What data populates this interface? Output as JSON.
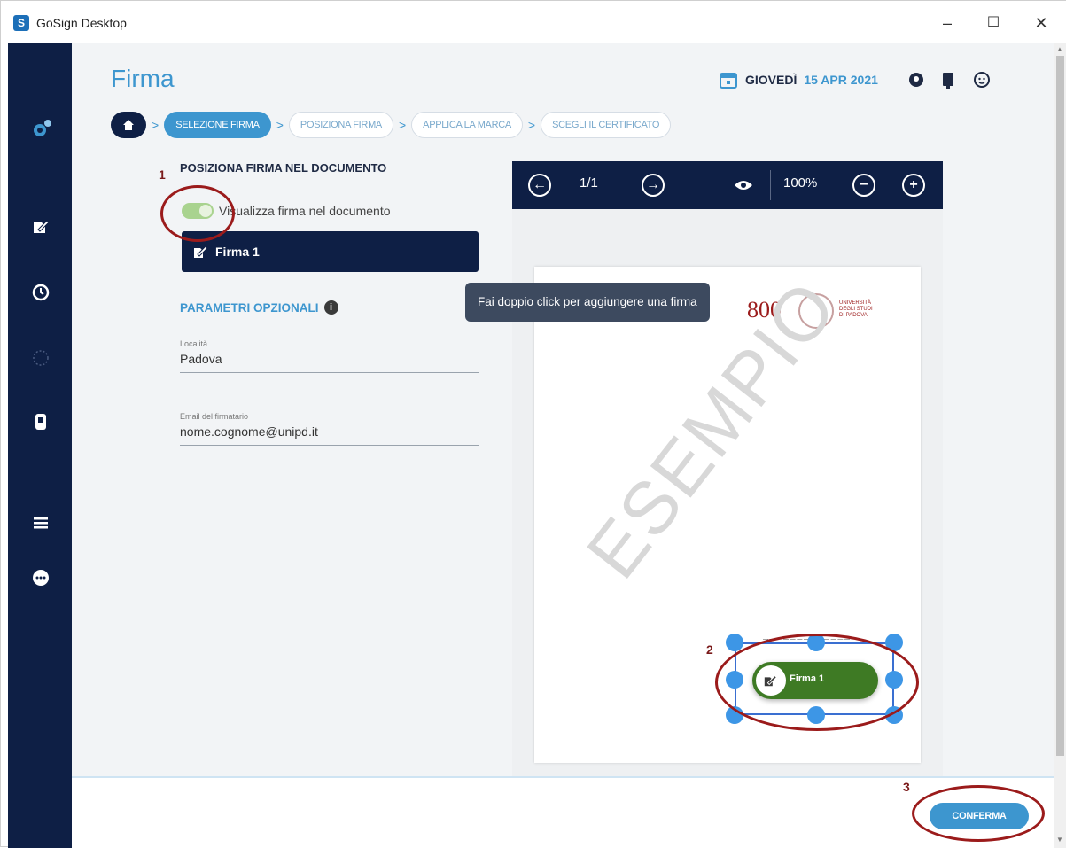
{
  "window": {
    "app_icon": "S",
    "title": "GoSign Desktop",
    "minimize": "–",
    "maximize": "☐",
    "close": "✕"
  },
  "header": {
    "page_title": "Firma",
    "date_day": "GIOVEDÌ",
    "date_rest": "15 APR 2021"
  },
  "breadcrumb": {
    "steps": [
      "SELEZIONE FIRMA",
      "POSIZIONA FIRMA",
      "APPLICA LA MARCA",
      "SCEGLI IL CERTIFICATO"
    ],
    "separator": ">"
  },
  "form": {
    "section_title": "POSIZIONA FIRMA NEL DOCUMENTO",
    "toggle_label": "Visualizza firma nel documento",
    "toggle_on": true,
    "signature_button": "Firma 1",
    "optional_title": "PARAMETRI OPZIONALI",
    "info_glyph": "i",
    "fields": [
      {
        "label": "Località",
        "value": "Padova"
      },
      {
        "label": "Email del firmatario",
        "value": "nome.cognome@unipd.it"
      }
    ]
  },
  "viewer": {
    "page_indicator": "1/1",
    "zoom": "100%",
    "prev_glyph": "←",
    "next_glyph": "→",
    "zoom_out_glyph": "−",
    "zoom_in_glyph": "+",
    "tooltip": "Fai doppio click per aggiungere una firma",
    "watermark": "ESEMPIO",
    "logo_number": "800",
    "logo_text": [
      "UNIVERSITÀ",
      "DEGLI STUDI",
      "DI PADOVA"
    ],
    "signature_label": "Firma 1"
  },
  "annotations": [
    "1",
    "2",
    "3"
  ],
  "footer": {
    "confirm_label": "CONFERMA"
  },
  "colors": {
    "sidebar": "#0e1f45",
    "accent": "#3d96cf",
    "signature_green": "#3e7a24",
    "annotation_red": "#9b1b1b"
  }
}
